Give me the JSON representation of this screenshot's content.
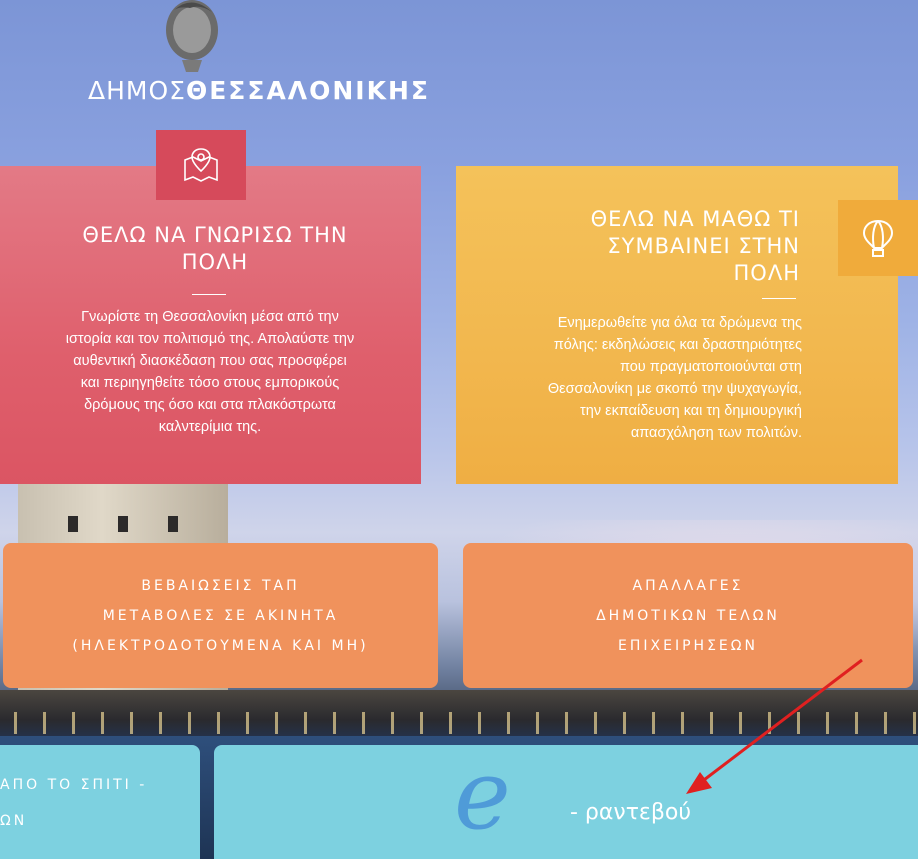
{
  "brand": {
    "prefix": "ΔΗΜΟΣ",
    "name": "ΘΕΣΣΑΛΟΝΙΚΗΣ"
  },
  "cards": {
    "know_city": {
      "icon": "map-pin-icon",
      "title_line1": "ΘΕΛΩ ΝΑ ΓΝΩΡΙΣΩ ΤΗΝ",
      "title_line2": "ΠΟΛΗ",
      "text_lines": [
        "Γνωρίστε τη Θεσσαλονίκη μέσα από την",
        "ιστορία και τον πολιτισμό της. Απολαύστε την",
        "αυθεντική διασκέδαση που σας προσφέρει",
        "και περιηγηθείτε τόσο στους εμπορικούς",
        "δρόμους της όσο και στα πλακόστρωτα",
        "καλντερίμια της."
      ]
    },
    "learn_city": {
      "icon": "hot-air-balloon-icon",
      "title_line1": "ΘΕΛΩ ΝΑ ΜΑΘΩ ΤΙ",
      "title_line2": "ΣΥΜΒΑΙΝΕΙ ΣΤΗΝ",
      "title_line3": "ΠΟΛΗ",
      "text_lines": [
        "Ενημερωθείτε για όλα τα δρώμενα της",
        "πόλης: εκδηλώσεις και δραστηριότητες",
        "που πραγματοποιούνται στη",
        "Θεσσαλονίκη με σκοπό την ψυχαγωγία,",
        "την εκπαίδευση και τη δημιουργική",
        "απασχόληση των πολιτών."
      ]
    }
  },
  "buttons": {
    "tap": [
      "ΒΕΒΑΙΩΣΕΙΣ ΤΑΠ",
      "ΜΕΤΑΒΟΛΕΣ ΣΕ ΑΚΙΝΗΤΑ",
      "(ΗΛΕΚΤΡΟΔΟΤΟΥΜΕΝΑ ΚΑΙ ΜΗ)"
    ],
    "exemptions": [
      "ΑΠΑΛΛΑΓΕΣ",
      "ΔΗΜΟΤΙΚΩΝ ΤΕΛΩΝ",
      "ΕΠΙΧΕΙΡΗΣΕΩΝ"
    ],
    "from_home": [
      "ΑΠΟ ΤΟ ΣΠΙΤΙ -",
      "ΩΝ"
    ],
    "e_appointment": {
      "letter": "e",
      "label": "- ραντεβού"
    }
  },
  "colors": {
    "pink": "#df5f6c",
    "yellow": "#f2b74e",
    "orange": "#f0925c",
    "teal": "#7dd1e0",
    "arrow": "#e02020"
  }
}
